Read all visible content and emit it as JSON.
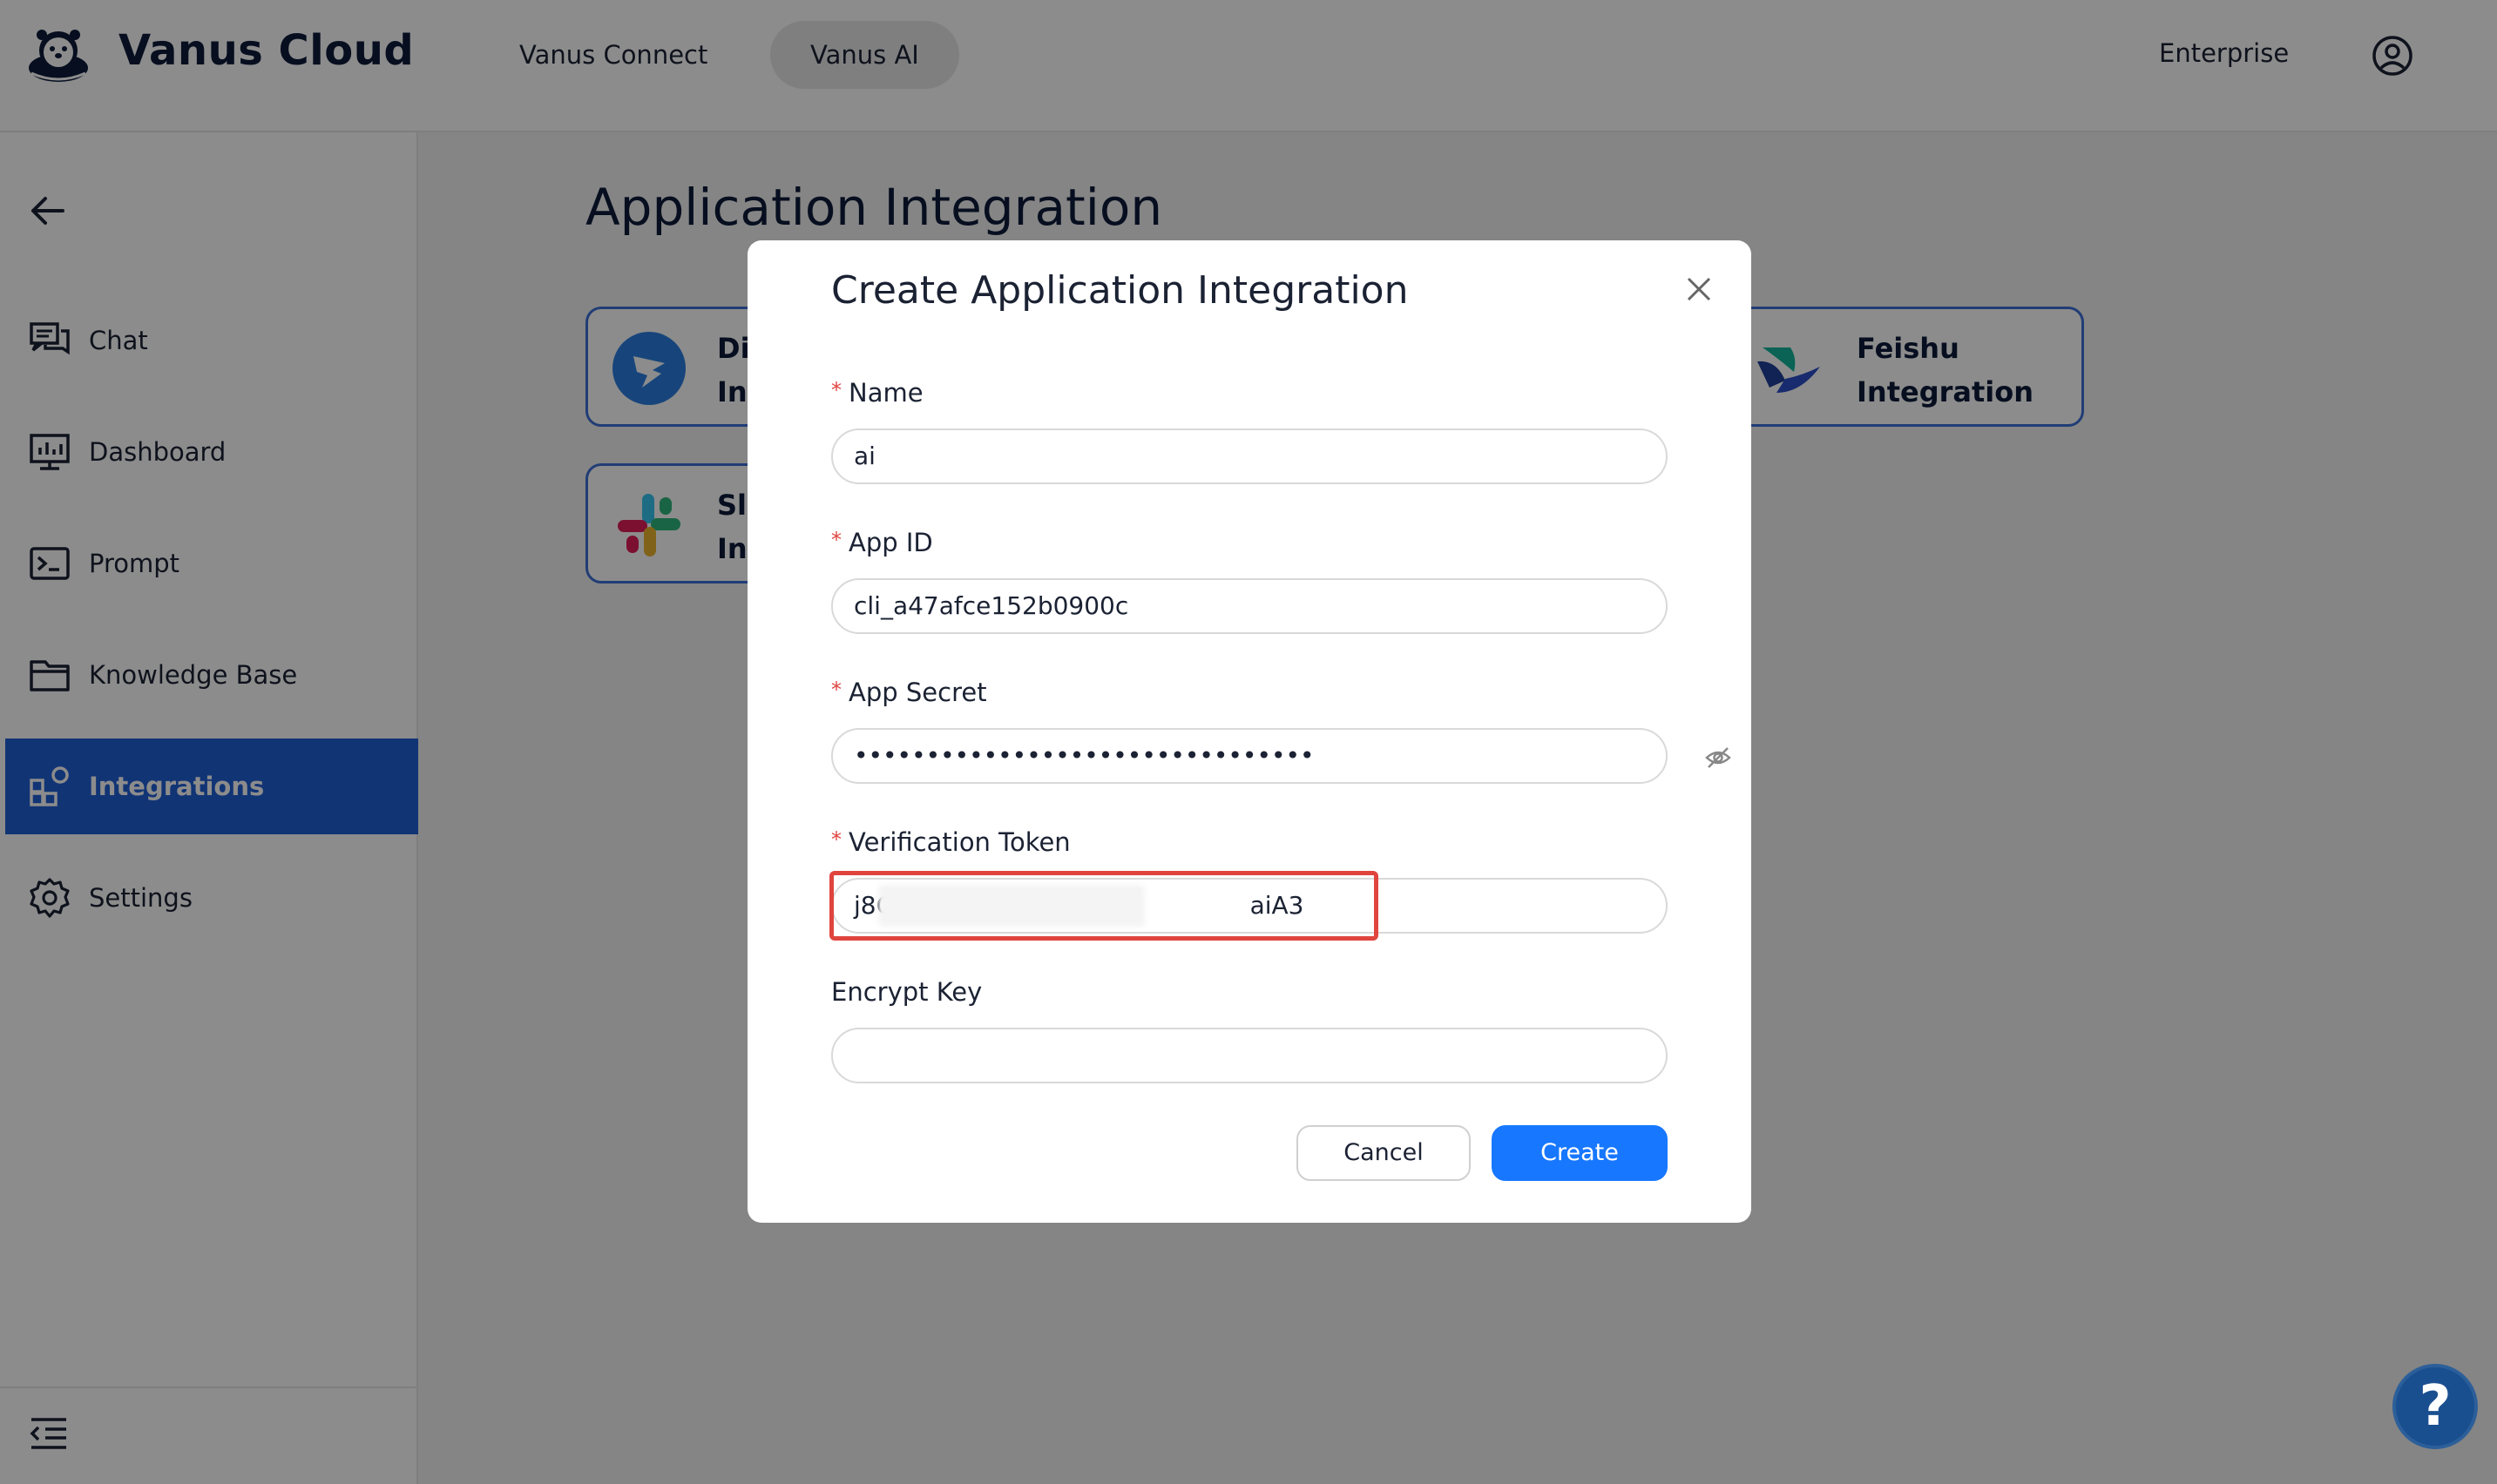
{
  "header": {
    "brand": "Vanus Cloud",
    "nav": [
      "Vanus Connect",
      "Vanus AI"
    ],
    "enterprise": "Enterprise"
  },
  "sidebar": {
    "items": [
      {
        "label": "Chat",
        "icon": "chat-icon"
      },
      {
        "label": "Dashboard",
        "icon": "dashboard-icon"
      },
      {
        "label": "Prompt",
        "icon": "prompt-icon"
      },
      {
        "label": "Knowledge Base",
        "icon": "folder-icon"
      },
      {
        "label": "Integrations",
        "icon": "integrations-icon",
        "active": true
      },
      {
        "label": "Settings",
        "icon": "gear-icon"
      }
    ]
  },
  "main": {
    "title": "Application Integration",
    "cards": [
      {
        "label": "Di\nInt",
        "icon": "dingtalk-icon"
      },
      {
        "label": "Sla\nInt",
        "icon": "slack-icon"
      },
      {
        "label": "Feishu\nIntegration",
        "icon": "feishu-icon"
      }
    ]
  },
  "modal": {
    "title": "Create Application Integration",
    "fields": {
      "name": {
        "label": "Name",
        "value": "ai",
        "required": true
      },
      "app_id": {
        "label": "App ID",
        "value": "cli_a47afce152b0900c",
        "required": true
      },
      "app_secret": {
        "label": "App Secret",
        "value": "••••••••••••••••••••••••••••••••",
        "required": true
      },
      "verification_token": {
        "label": "Verification Token",
        "value": "j8C                                              aiA3",
        "required": true
      },
      "encrypt_key": {
        "label": "Encrypt Key",
        "value": "",
        "required": false
      }
    },
    "cancel_label": "Cancel",
    "create_label": "Create"
  },
  "help_label": "?",
  "colors": {
    "accent": "#1f5fd6",
    "primary_button": "#1777ff",
    "highlight": "#e0443e"
  }
}
